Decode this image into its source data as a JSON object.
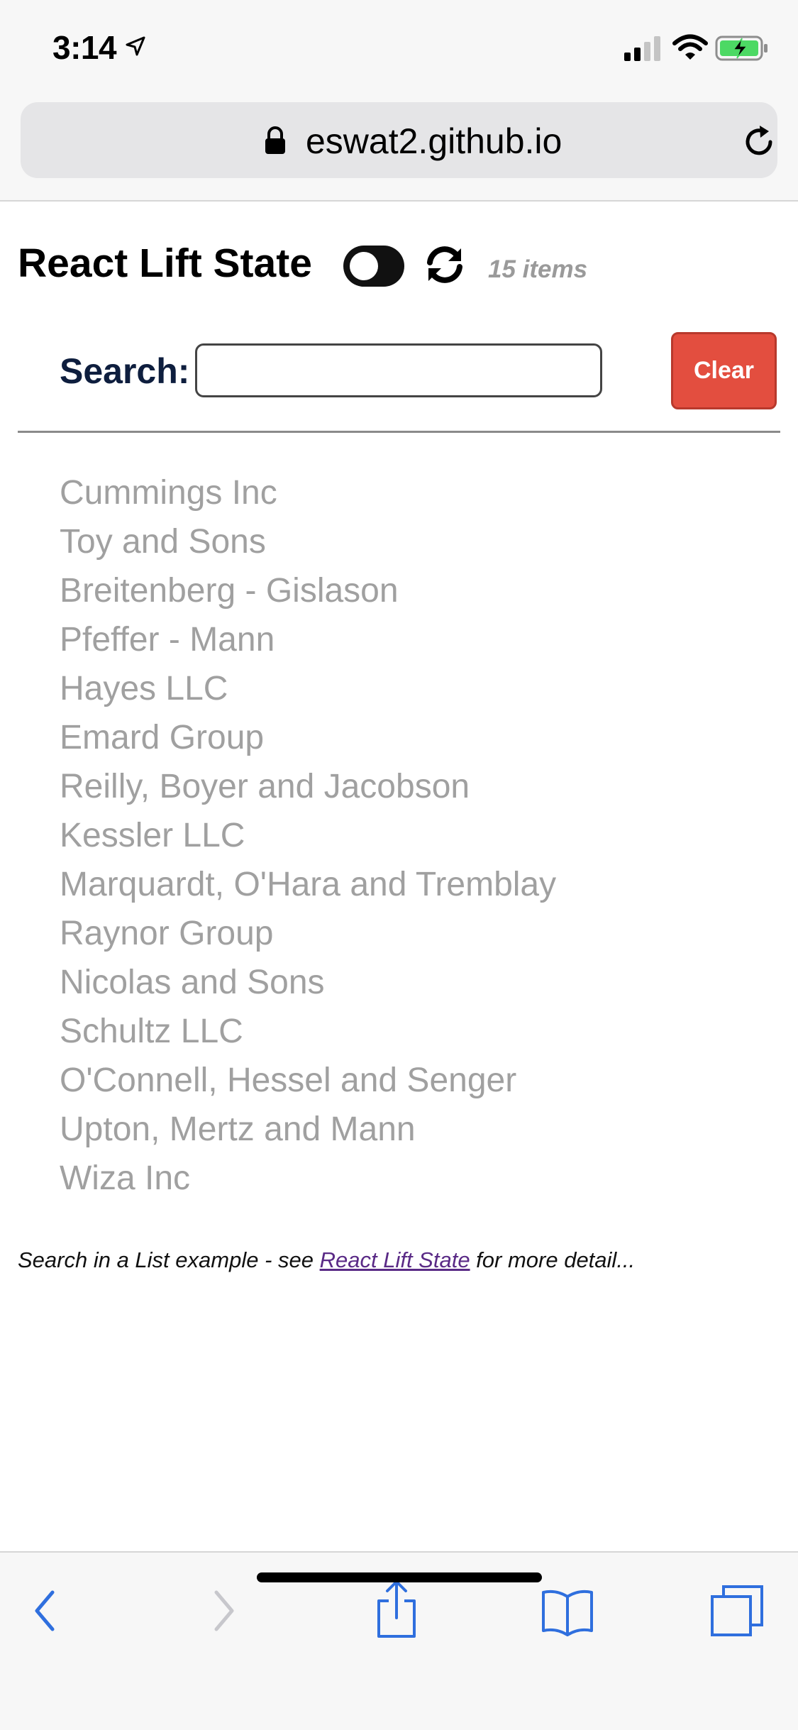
{
  "status_bar": {
    "time": "3:14",
    "icons": [
      "location-arrow-icon",
      "cellular-signal-icon",
      "wifi-icon",
      "battery-charging-icon"
    ]
  },
  "browser": {
    "url": "eswat2.github.io"
  },
  "header": {
    "title": "React Lift State",
    "item_count": "15 items",
    "toggle_state": "off"
  },
  "search": {
    "label": "Search:",
    "value": "",
    "placeholder": "",
    "clear_label": "Clear"
  },
  "items": [
    "Cummings Inc",
    "Toy and Sons",
    "Breitenberg - Gislason",
    "Pfeffer - Mann",
    "Hayes LLC",
    "Emard Group",
    "Reilly, Boyer and Jacobson",
    "Kessler LLC",
    "Marquardt, O'Hara and Tremblay",
    "Raynor Group",
    "Nicolas and Sons",
    "Schultz LLC",
    "O'Connell, Hessel and Senger",
    "Upton, Mertz and Mann",
    "Wiza Inc"
  ],
  "footer": {
    "prefix": "Search in a List example - see ",
    "link_text": "React Lift State",
    "suffix": " for more detail..."
  },
  "colors": {
    "clear_button": "#e34e3f",
    "search_label": "#0e1e3e",
    "list_text": "#a0a0a0",
    "toolbar_accent": "#2f6fde",
    "link": "#5a2a86"
  }
}
